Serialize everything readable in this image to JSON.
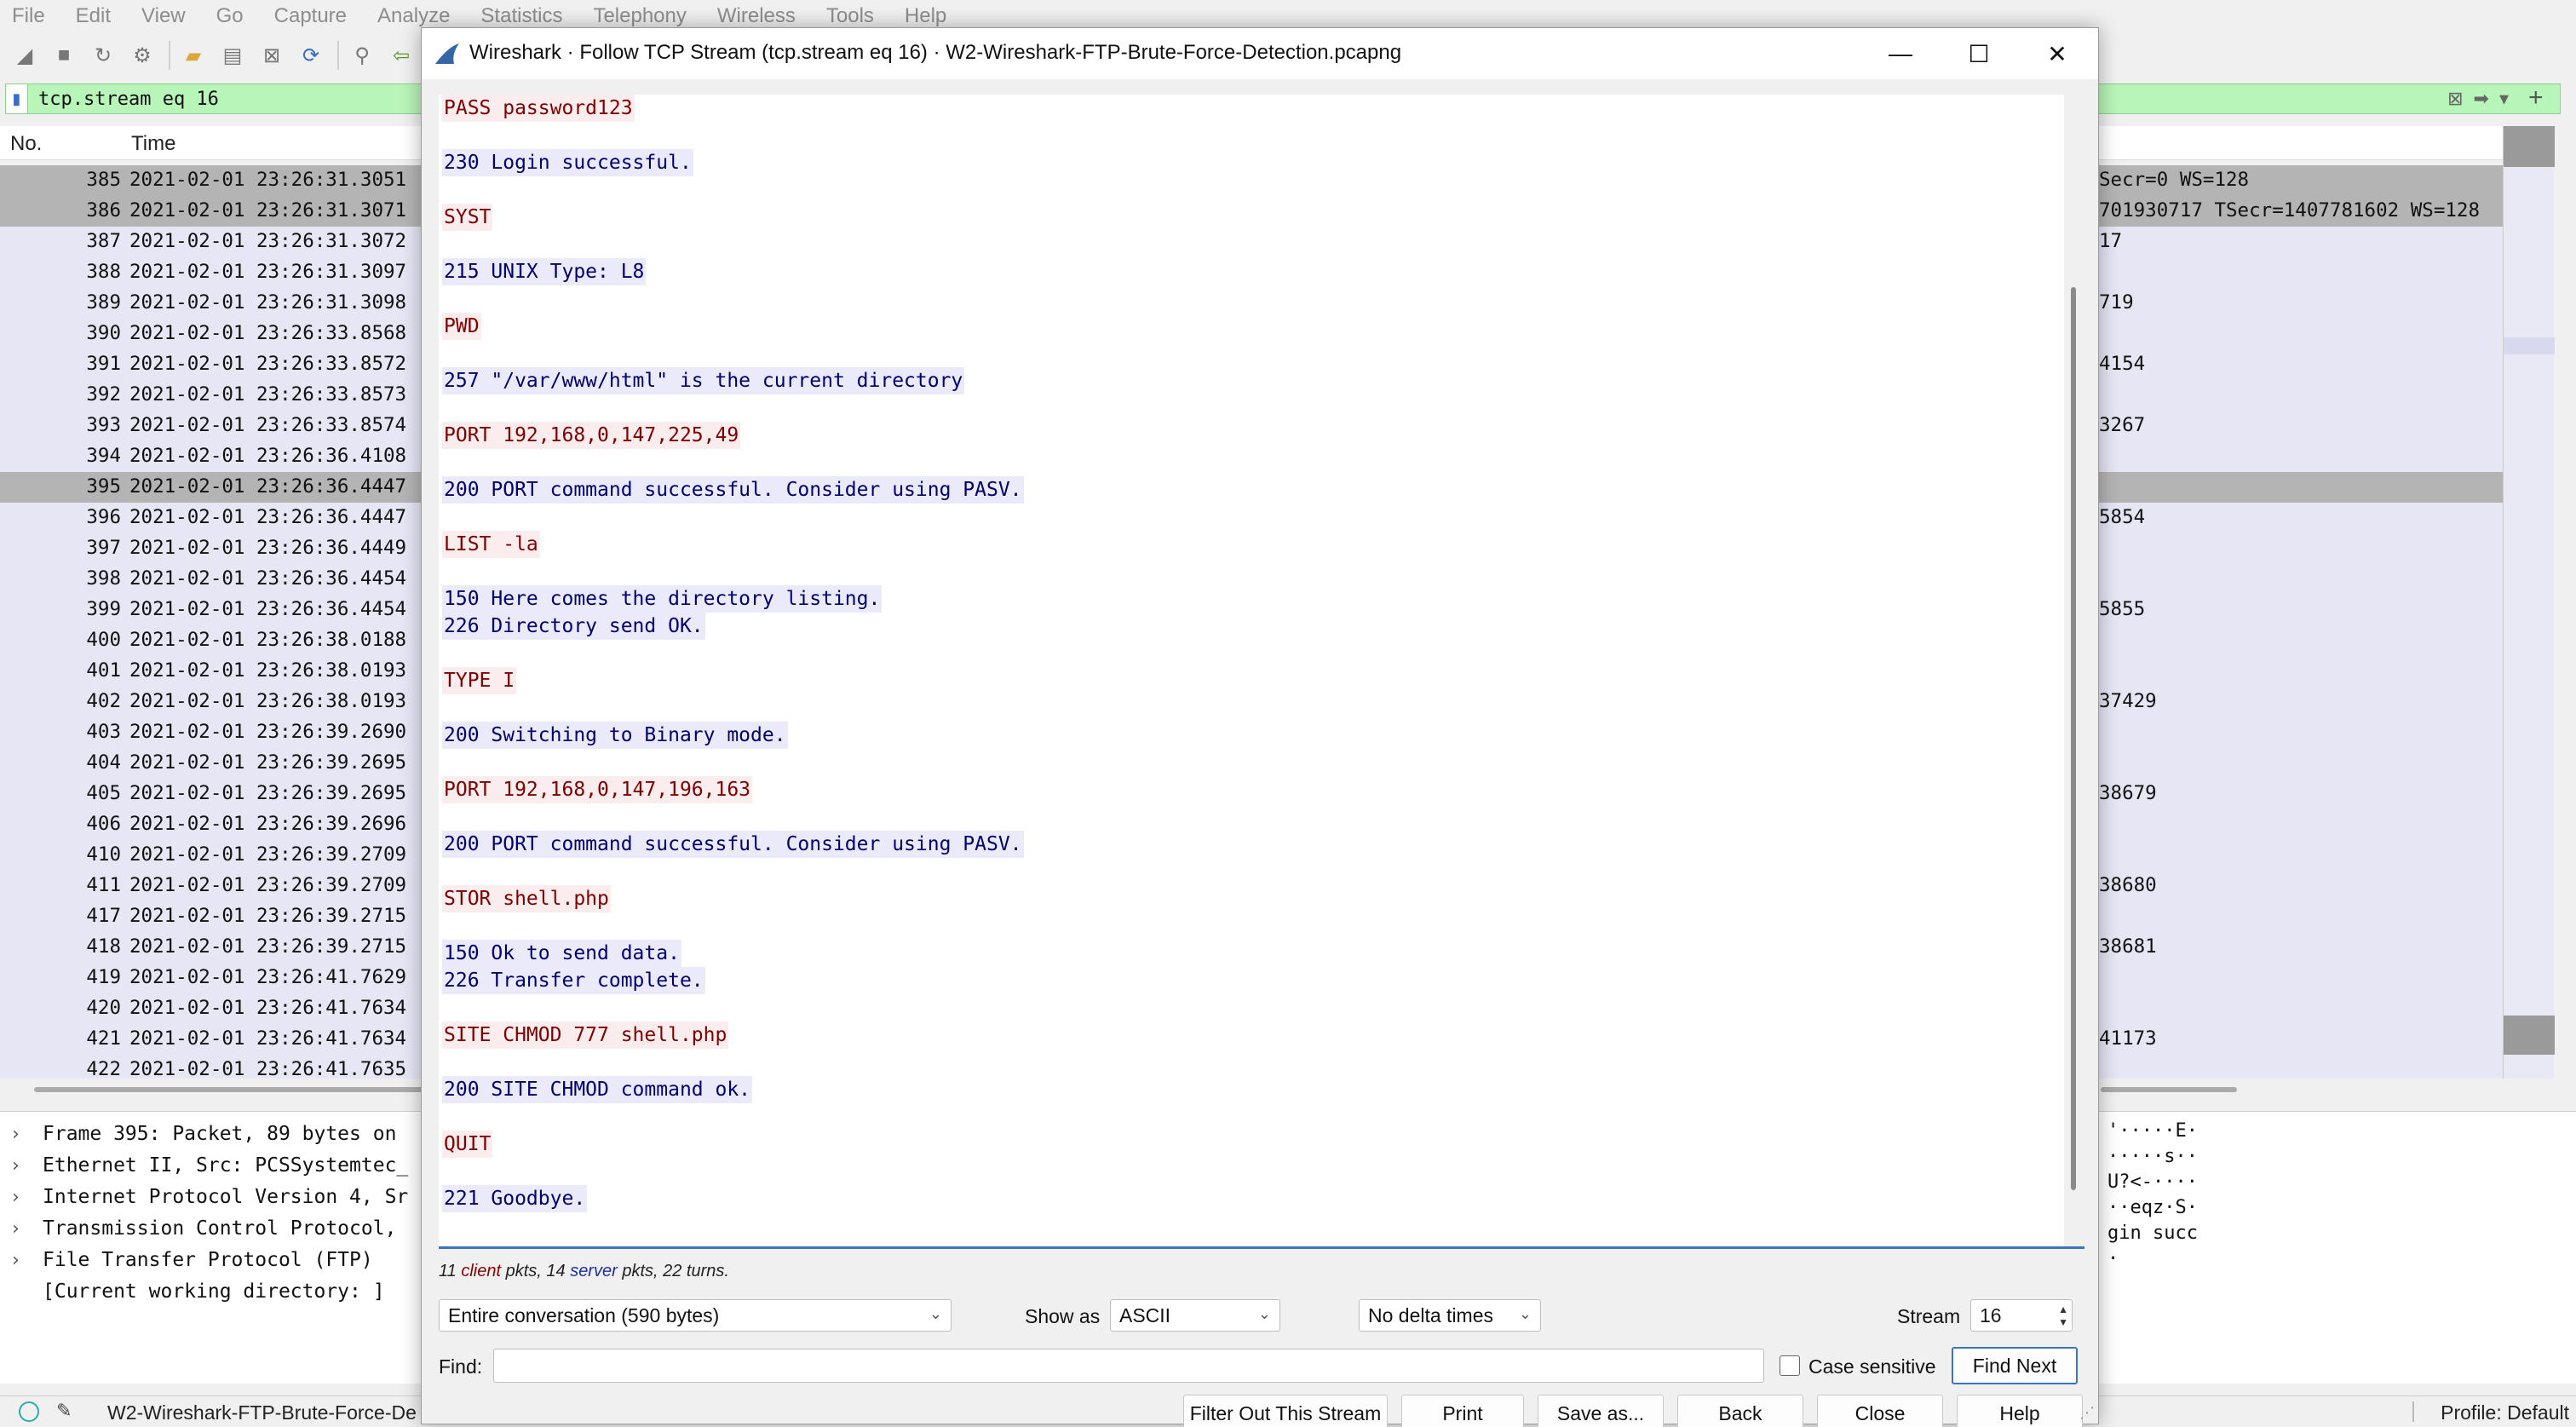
{
  "menubar": [
    "File",
    "Edit",
    "View",
    "Go",
    "Capture",
    "Analyze",
    "Statistics",
    "Telephony",
    "Wireless",
    "Tools",
    "Help"
  ],
  "filter": {
    "value": "tcp.stream eq 16"
  },
  "columns": {
    "no": "No.",
    "time": "Time"
  },
  "packets": [
    {
      "no": "385",
      "time": "2021-02-01 23:26:31.3051",
      "info": "Secr=0 WS=128",
      "selected": true
    },
    {
      "no": "386",
      "time": "2021-02-01 23:26:31.3071",
      "info": "701930717 TSecr=1407781602 WS=128",
      "selected": true
    },
    {
      "no": "387",
      "time": "2021-02-01 23:26:31.3072",
      "info": "17"
    },
    {
      "no": "388",
      "time": "2021-02-01 23:26:31.3097",
      "info": ""
    },
    {
      "no": "389",
      "time": "2021-02-01 23:26:31.3098",
      "info": "719"
    },
    {
      "no": "390",
      "time": "2021-02-01 23:26:33.8568",
      "info": ""
    },
    {
      "no": "391",
      "time": "2021-02-01 23:26:33.8572",
      "info": "4154"
    },
    {
      "no": "392",
      "time": "2021-02-01 23:26:33.8573",
      "info": ""
    },
    {
      "no": "393",
      "time": "2021-02-01 23:26:33.8574",
      "info": "3267"
    },
    {
      "no": "394",
      "time": "2021-02-01 23:26:36.4108",
      "info": ""
    },
    {
      "no": "395",
      "time": "2021-02-01 23:26:36.4447",
      "info": "",
      "selected": true
    },
    {
      "no": "396",
      "time": "2021-02-01 23:26:36.4447",
      "info": "5854"
    },
    {
      "no": "397",
      "time": "2021-02-01 23:26:36.4449",
      "info": ""
    },
    {
      "no": "398",
      "time": "2021-02-01 23:26:36.4454",
      "info": ""
    },
    {
      "no": "399",
      "time": "2021-02-01 23:26:36.4454",
      "info": "5855"
    },
    {
      "no": "400",
      "time": "2021-02-01 23:26:38.0188",
      "info": ""
    },
    {
      "no": "401",
      "time": "2021-02-01 23:26:38.0193",
      "info": ""
    },
    {
      "no": "402",
      "time": "2021-02-01 23:26:38.0193",
      "info": "37429"
    },
    {
      "no": "403",
      "time": "2021-02-01 23:26:39.2690",
      "info": ""
    },
    {
      "no": "404",
      "time": "2021-02-01 23:26:39.2695",
      "info": ""
    },
    {
      "no": "405",
      "time": "2021-02-01 23:26:39.2695",
      "info": "38679"
    },
    {
      "no": "406",
      "time": "2021-02-01 23:26:39.2696",
      "info": ""
    },
    {
      "no": "410",
      "time": "2021-02-01 23:26:39.2709",
      "info": ""
    },
    {
      "no": "411",
      "time": "2021-02-01 23:26:39.2709",
      "info": "38680"
    },
    {
      "no": "417",
      "time": "2021-02-01 23:26:39.2715",
      "info": ""
    },
    {
      "no": "418",
      "time": "2021-02-01 23:26:39.2715",
      "info": "38681"
    },
    {
      "no": "419",
      "time": "2021-02-01 23:26:41.7629",
      "info": ""
    },
    {
      "no": "420",
      "time": "2021-02-01 23:26:41.7634",
      "info": ""
    },
    {
      "no": "421",
      "time": "2021-02-01 23:26:41.7634",
      "info": "41173"
    },
    {
      "no": "422",
      "time": "2021-02-01 23:26:41.7635",
      "info": ""
    }
  ],
  "details": [
    "Frame 395: Packet, 89 bytes on",
    "Ethernet II, Src: PCSSystemtec_",
    "Internet Protocol Version 4, Sr",
    "Transmission Control Protocol,",
    "File Transfer Protocol (FTP)",
    "[Current working directory: ]"
  ],
  "bytes": [
    "'·····E·",
    "·····s··",
    "U?<-····",
    "··eqz·S·",
    "gin succ",
    "·"
  ],
  "statusbar": {
    "file": "W2-Wireshark-FTP-Brute-Force-De",
    "profile": "Profile: Default"
  },
  "dialog": {
    "title": "Wireshark · Follow TCP Stream (tcp.stream eq 16) · W2-Wireshark-FTP-Brute-Force-Detection.pcapng",
    "stream_lines": [
      {
        "text": "PASS password123",
        "side": "client"
      },
      {
        "text": "230 Login successful.",
        "side": "server"
      },
      {
        "text": "SYST",
        "side": "client"
      },
      {
        "text": "215 UNIX Type: L8",
        "side": "server"
      },
      {
        "text": "PWD",
        "side": "client"
      },
      {
        "text": "257 \"/var/www/html\" is the current directory",
        "side": "server"
      },
      {
        "text": "PORT 192,168,0,147,225,49",
        "side": "client"
      },
      {
        "text": "200 PORT command successful. Consider using PASV.",
        "side": "server"
      },
      {
        "text": "LIST -la",
        "side": "client"
      },
      {
        "text": "150 Here comes the directory listing.",
        "side": "server"
      },
      {
        "text": "226 Directory send OK.",
        "side": "server"
      },
      {
        "text": "TYPE I",
        "side": "client"
      },
      {
        "text": "200 Switching to Binary mode.",
        "side": "server"
      },
      {
        "text": "PORT 192,168,0,147,196,163",
        "side": "client"
      },
      {
        "text": "200 PORT command successful. Consider using PASV.",
        "side": "server"
      },
      {
        "text": "STOR shell.php",
        "side": "client"
      },
      {
        "text": "150 Ok to send data.",
        "side": "server"
      },
      {
        "text": "226 Transfer complete.",
        "side": "server"
      },
      {
        "text": "SITE CHMOD 777 shell.php",
        "side": "client"
      },
      {
        "text": "200 SITE CHMOD command ok.",
        "side": "server"
      },
      {
        "text": "QUIT",
        "side": "client"
      },
      {
        "text": "221 Goodbye.",
        "side": "server"
      }
    ],
    "stats": {
      "client_count": "11",
      "client_word": "client",
      "middle": " pkts, 14 ",
      "server_word": "server",
      "tail": " pkts, 22 turns."
    },
    "conversation": "Entire conversation (590 bytes)",
    "show_as_label": "Show as",
    "show_as": "ASCII",
    "delta": "No delta times",
    "stream_label": "Stream",
    "stream_value": "16",
    "find_label": "Find:",
    "find_value": "",
    "case_sensitive": "Case sensitive",
    "find_next": "Find Next",
    "buttons": {
      "filter_out": "Filter Out This Stream",
      "print": "Print",
      "save_as": "Save as...",
      "back": "Back",
      "close": "Close",
      "help": "Help"
    }
  }
}
